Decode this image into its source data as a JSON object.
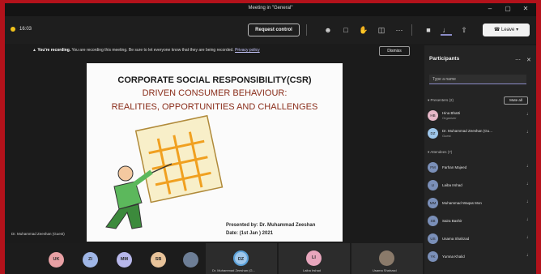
{
  "window": {
    "title": "Meeting in \"General\""
  },
  "toolbar": {
    "timer": "16:03",
    "request_control": "Request control",
    "leave": "Leave"
  },
  "banner": {
    "lead": "You're recording.",
    "text": "You are recording this meeting. Be sure to let everyone know that they are being recorded.",
    "link": "Privacy policy",
    "dismiss": "Dismiss"
  },
  "slide": {
    "title_line1": "CORPORATE SOCIAL RESPONSIBILITY(CSR)",
    "title_line2": "DRIVEN CONSUMER BEHAVIOUR:",
    "title_line3": "REALITIES, OPPORTUNITIES AND CHALLENGES",
    "presented_by": "Presented by: Dr. Muhammad Zeeshan",
    "date": "Date: (1st Jan ) 2021"
  },
  "speaker_tag": "Dr. Muhammad Zeeshan (Guest)",
  "participants": {
    "title": "Participants",
    "search_placeholder": "Type a name",
    "presenters_label": "Presenters (2)",
    "mute_all": "Mute all",
    "attendees_label": "Attendees (7)",
    "presenters": [
      {
        "initials": "HB",
        "name": "Hina Bhatti",
        "role": "Organizer"
      },
      {
        "initials": "DZ",
        "name": "Dr. Muhammad Zeeshan (Gu...",
        "role": "Guest"
      }
    ],
    "attendees": [
      {
        "initials": "FM",
        "name": "Farhan Majeed"
      },
      {
        "initials": "LI",
        "name": "Laiba Irshad"
      },
      {
        "initials": "MM",
        "name": "Muhammad Waqas Mon"
      },
      {
        "initials": "SB",
        "name": "Saira Bashir"
      },
      {
        "initials": "US",
        "name": "Usama Shahzad"
      },
      {
        "initials": "YK",
        "name": "Yumna Khalid"
      }
    ]
  },
  "strip": {
    "avatars": [
      {
        "initials": "UK",
        "color": "#e8a0a4"
      },
      {
        "initials": "ZI",
        "color": "#9fb6e6"
      },
      {
        "initials": "MM",
        "color": "#b7b7ea"
      },
      {
        "initials": "SB",
        "color": "#e8c39a"
      }
    ],
    "tiles": [
      {
        "initials": "DZ",
        "name": "Dr. Muhammad Zeeshan (G...",
        "color": "#9ec6ea"
      },
      {
        "initials": "LI",
        "name": "Laiba Irshad",
        "color": "#e8a6bd"
      },
      {
        "initials": "",
        "name": "Usama Shahzad",
        "color": "#8a7a6a"
      }
    ]
  }
}
